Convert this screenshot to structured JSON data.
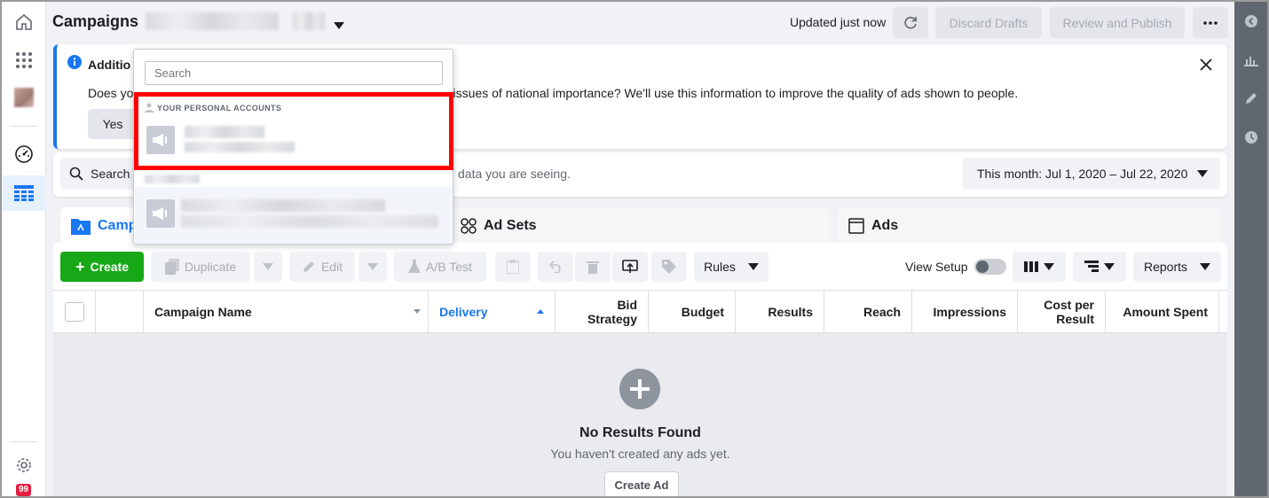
{
  "header": {
    "title": "Campaigns",
    "updated": "Updated just now",
    "discard_drafts": "Discard Drafts",
    "review_publish": "Review and Publish"
  },
  "left_nav": {
    "notification_count": "99"
  },
  "banner": {
    "title": "Additio",
    "question_start": "Does yo",
    "question_end": "r issues of national importance? We'll use this information to improve the quality of ads shown to people.",
    "yes_label": "Yes"
  },
  "filter_bar": {
    "search_label": "Search",
    "info_text": "data you are seeing.",
    "date_range": "This month: Jul 1, 2020 – Jul 22, 2020"
  },
  "tabs": [
    {
      "label": "Campa"
    },
    {
      "label": "Ad Sets"
    },
    {
      "label": "Ads"
    }
  ],
  "toolbar": {
    "create": "Create",
    "duplicate": "Duplicate",
    "edit": "Edit",
    "ab_test": "A/B Test",
    "rules": "Rules",
    "view_setup": "View Setup",
    "reports": "Reports"
  },
  "table": {
    "columns": {
      "campaign_name": "Campaign Name",
      "delivery": "Delivery",
      "bid_strategy_1": "Bid",
      "bid_strategy_2": "Strategy",
      "budget": "Budget",
      "results": "Results",
      "reach": "Reach",
      "impressions": "Impressions",
      "cost_per_result_1": "Cost per",
      "cost_per_result_2": "Result",
      "amount_spent": "Amount Spent"
    },
    "empty": {
      "title": "No Results Found",
      "subtitle": "You haven't created any ads yet.",
      "button": "Create Ad"
    }
  },
  "dropdown": {
    "search_placeholder": "Search",
    "section_title": "YOUR PERSONAL ACCOUNTS"
  },
  "colors": {
    "accent": "#1877f2",
    "create_green": "#17a817",
    "highlight_red": "#ff0000"
  }
}
